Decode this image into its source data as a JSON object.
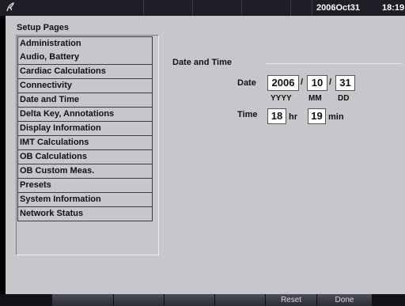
{
  "topbar": {
    "date": "2006Oct31",
    "time": "18:19"
  },
  "setup_pages": {
    "title": "Setup Pages",
    "items": [
      "Administration",
      "Audio, Battery",
      "Cardiac Calculations",
      "Connectivity",
      "Date and Time",
      "Delta Key, Annotations",
      "Display Information",
      "IMT Calculations",
      "OB Calculations",
      "OB Custom Meas.",
      "Presets",
      "System Information",
      "Network Status"
    ],
    "selected": "Date and Time"
  },
  "date_time": {
    "section_title": "Date and Time",
    "date_label": "Date",
    "year": "2006",
    "month": "10",
    "day": "31",
    "separator": "/",
    "year_hint": "YYYY",
    "month_hint": "MM",
    "day_hint": "DD",
    "time_label": "Time",
    "hour": "18",
    "hour_unit": "hr",
    "minute": "19",
    "minute_unit": "min"
  },
  "softkeys": {
    "reset": "Reset",
    "done": "Done"
  },
  "icons": {
    "logo": "brand-logo-icon"
  },
  "colors": {
    "panel": "#c8c6ca",
    "topbar": "#1e1f26"
  }
}
